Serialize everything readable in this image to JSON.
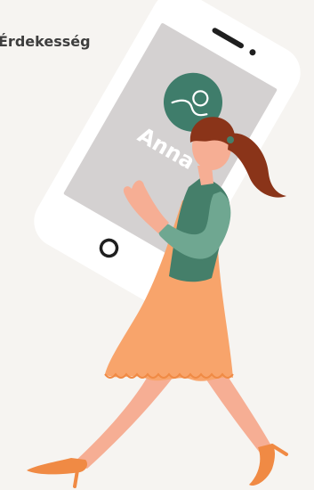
{
  "heading": "Érdekesség",
  "phone_screen": {
    "profile_name": "Anna",
    "avatar_icon": "avatar-icon"
  },
  "colors": {
    "background": "#f6f4f1",
    "phone_body": "#ffffff",
    "phone_screen": "#d4d1d1",
    "avatar_circle": "#3f7d6b",
    "jacket": "#457f6a",
    "jacket_light": "#6fa791",
    "dress": "#f8a46b",
    "skin": "#f6ae94",
    "hair": "#8a3419",
    "shoes": "#f08a44"
  }
}
